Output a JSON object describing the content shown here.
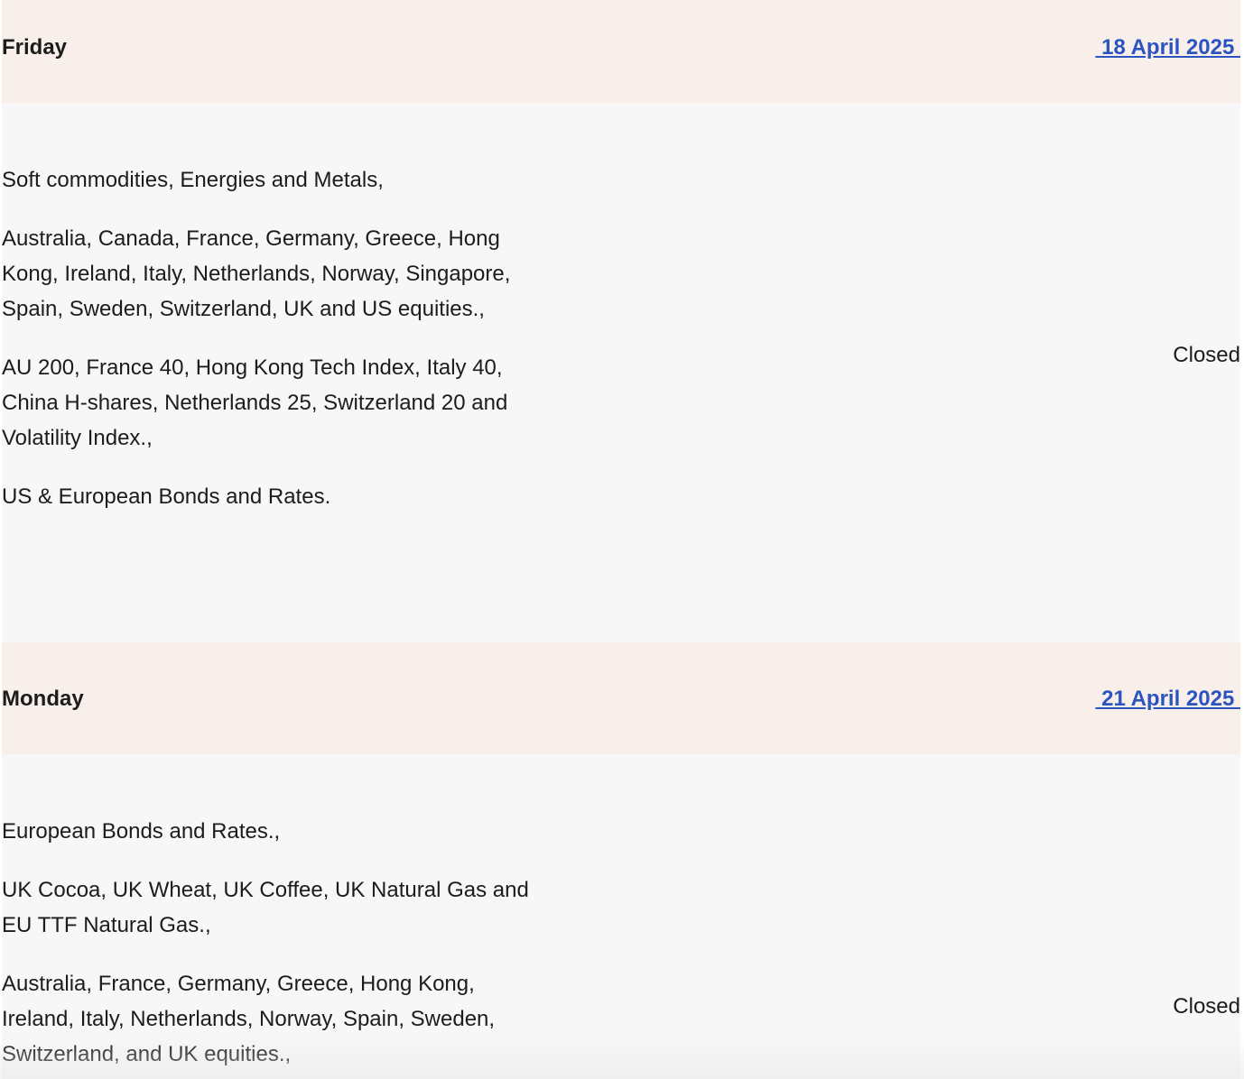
{
  "days": [
    {
      "day": "Friday",
      "date": " 18 April 2025 ",
      "status": "Closed",
      "markets": [
        "Soft commodities, Energies and Metals,",
        "Australia, Canada, France, Germany, Greece, Hong Kong, Ireland, Italy, Netherlands, Norway, Singapore, Spain, Sweden, Switzerland, UK and US equities.,",
        "AU 200, France 40, Hong Kong Tech Index, Italy 40, China H-shares, Netherlands 25, Switzerland 20 and Volatility Index.,",
        "US & European Bonds and Rates."
      ]
    },
    {
      "day": "Monday",
      "date": " 21 April 2025 ",
      "status": "Closed",
      "markets": [
        "European Bonds and Rates.,",
        "UK Cocoa, UK Wheat, UK Coffee, UK Natural Gas and EU TTF Natural Gas.,",
        "Australia, France, Germany, Greece, Hong Kong, Ireland, Italy, Netherlands, Norway, Spain, Sweden, Switzerland, and UK equities.,"
      ]
    }
  ]
}
